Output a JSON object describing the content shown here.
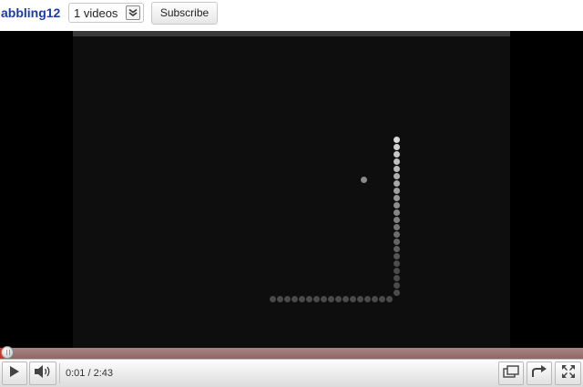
{
  "channel": {
    "name": "abbling12",
    "videos_count": "1 videos",
    "toggle_icon": "double-chevron-down-icon",
    "subscribe_label": "Subscribe"
  },
  "player": {
    "current_time": "0:01",
    "time_separator": " / ",
    "duration": "2:43",
    "progress_fraction": 0.006,
    "progress_color": "#8f6664",
    "icons": [
      "play-icon",
      "volume-icon",
      "popout-icon",
      "share-icon",
      "fullscreen-icon"
    ]
  },
  "game": {
    "background": "#0e0e0e",
    "snake_head_color": "#d8d8d8",
    "snake_tail_color": "#4a4a4a",
    "food_color": "#8a8a8a"
  }
}
